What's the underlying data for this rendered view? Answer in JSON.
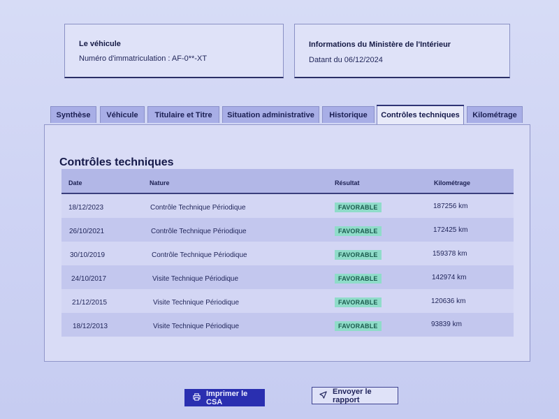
{
  "vehicle_card": {
    "title": "Le véhicule",
    "registration": "Numéro d'immatriculation : AF-0**-XT"
  },
  "ministry_card": {
    "title": "Informations du Ministère de l'Intérieur",
    "date": "Datant du 06/12/2024"
  },
  "tabs": [
    {
      "label": "Synthèse",
      "active": false
    },
    {
      "label": "Véhicule",
      "active": false
    },
    {
      "label": "Titulaire et Titre",
      "active": false
    },
    {
      "label": "Situation administrative",
      "active": false
    },
    {
      "label": "Historique",
      "active": false
    },
    {
      "label": "Contrôles techniques",
      "active": true
    },
    {
      "label": "Kilométrage",
      "active": false
    }
  ],
  "section_title": "Contrôles techniques",
  "table": {
    "headers": {
      "date": "Date",
      "nature": "Nature",
      "result": "Résultat",
      "mileage": "Kilométrage"
    },
    "rows": [
      {
        "date": "18/12/2023",
        "nature": "Contrôle Technique Périodique",
        "result": "FAVORABLE",
        "mileage": "187256 km"
      },
      {
        "date": "26/10/2021",
        "nature": "Contrôle Technique Périodique",
        "result": "FAVORABLE",
        "mileage": "172425 km"
      },
      {
        "date": "30/10/2019",
        "nature": "Contrôle Technique Périodique",
        "result": "FAVORABLE",
        "mileage": "159378 km"
      },
      {
        "date": "24/10/2017",
        "nature": "Visite Technique Périodique",
        "result": "FAVORABLE",
        "mileage": "142974 km"
      },
      {
        "date": "21/12/2015",
        "nature": "Visite Technique Périodique",
        "result": "FAVORABLE",
        "mileage": "120636 km"
      },
      {
        "date": "18/12/2013",
        "nature": "Visite Technique Périodique",
        "result": "FAVORABLE",
        "mileage": "93839 km"
      }
    ]
  },
  "buttons": {
    "print": {
      "label": "Imprimer le CSA",
      "icon": "printer-icon"
    },
    "send": {
      "label": "Envoyer le rapport",
      "icon": "send-icon"
    }
  },
  "colors": {
    "primary": "#2a2fb0",
    "badge_bg": "#8fdcc9",
    "badge_text": "#1a5a4d"
  }
}
